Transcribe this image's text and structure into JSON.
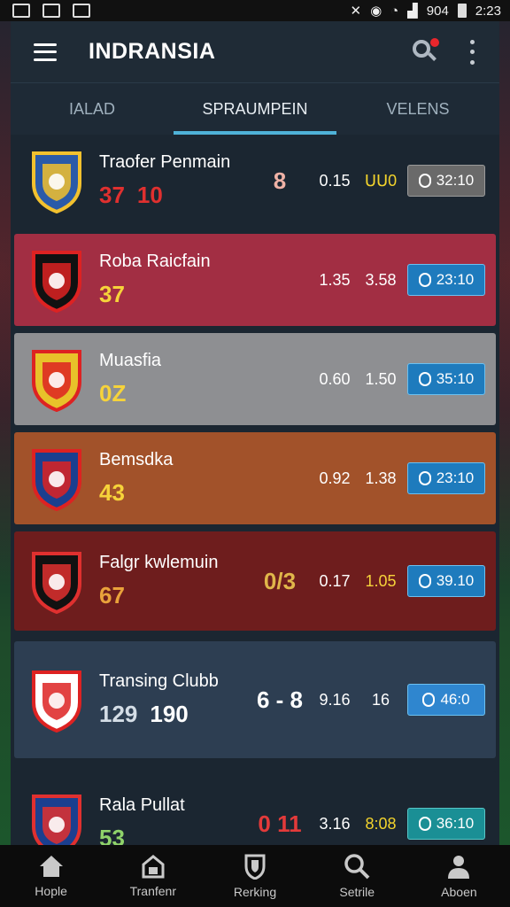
{
  "status_bar": {
    "battery": "904",
    "time": "2:23"
  },
  "app": {
    "title": "INDRANSIA"
  },
  "tabs": [
    {
      "label": "IALAD",
      "active": false
    },
    {
      "label": "SPRAUMPEIN",
      "active": true
    },
    {
      "label": "VELENS",
      "active": false
    }
  ],
  "rows": [
    {
      "name": "Traofer Penmain",
      "score_a": "37",
      "score_b": "10",
      "mid": "8",
      "stat_a": "0.15",
      "stat_b": "ᑌᑌ0",
      "time": "32:10",
      "bg": "#1b2631",
      "score_color": "#e0302f",
      "mid_color": "#f0b2a6",
      "statb_color": "#f2d32c",
      "btn_bg": "#6a6a6a",
      "btn_border": "#9a9a9a"
    },
    {
      "name": "Roba Raicfain",
      "score_a": "37",
      "score_b": "",
      "mid": "",
      "stat_a": "1.35",
      "stat_b": "3.58",
      "time": "23:10",
      "bg": "#a22e43",
      "score_color": "#f6d33a",
      "mid_color": "#fff",
      "statb_color": "#fff",
      "btn_bg": "#1e7bbd",
      "btn_border": "#6cc0f0"
    },
    {
      "name": "Muasfia",
      "score_a": "0Z",
      "score_b": "",
      "mid": "",
      "stat_a": "0.60",
      "stat_b": "1.50",
      "time": "35:10",
      "bg": "#8e8f92",
      "score_color": "#f6d33a",
      "mid_color": "#fff",
      "statb_color": "#fff",
      "btn_bg": "#1e7bbd",
      "btn_border": "#6cc0f0"
    },
    {
      "name": "Bemsdka",
      "score_a": "43",
      "score_b": "",
      "mid": "",
      "stat_a": "0.92",
      "stat_b": "1.38",
      "time": "23:10",
      "bg": "#a2522a",
      "score_color": "#f6d33a",
      "mid_color": "#fff",
      "statb_color": "#fff",
      "btn_bg": "#1e7bbd",
      "btn_border": "#6cc0f0"
    },
    {
      "name": "Falgr kwlemuin",
      "score_a": "67",
      "score_b": "",
      "mid": "0/3",
      "stat_a": "0.17",
      "stat_b": "1.05",
      "time": "39.10",
      "bg": "#6e1d1d",
      "score_color": "#e9a23b",
      "mid_color": "#e0b64a",
      "statb_color": "#f6d33a",
      "btn_bg": "#1e7bbd",
      "btn_border": "#6cc0f0"
    },
    {
      "name": "Transing Clubb",
      "score_a": "129",
      "score_b": "190",
      "mid": "6 - 8",
      "stat_a": "9.16",
      "stat_b": "16",
      "time": "46:0",
      "bg": "#2d3e52",
      "score_color": "#d4dde6",
      "mid_color": "#ffffff",
      "statb_color": "#ffffff",
      "btn_bg": "#2f86cf",
      "btn_border": "#6cc0f0"
    },
    {
      "name": "Rala Pullat",
      "score_a": "53",
      "score_b": "",
      "mid": "0 11",
      "stat_a": "3.16",
      "stat_b": "8:08",
      "time": "36:10",
      "bg": "#1b2631",
      "score_color": "#8fd36a",
      "mid_color": "#e33a3a",
      "statb_color": "#f2d32c",
      "btn_bg": "#1a8f95",
      "btn_border": "#58c7c7"
    }
  ],
  "bottom_nav": [
    {
      "label": "Hople",
      "icon": "home-icon"
    },
    {
      "label": "Tranfenr",
      "icon": "transfer-icon"
    },
    {
      "label": "Rerking",
      "icon": "shield-icon"
    },
    {
      "label": "Setrile",
      "icon": "search-icon"
    },
    {
      "label": "Aboen",
      "icon": "person-icon"
    }
  ]
}
